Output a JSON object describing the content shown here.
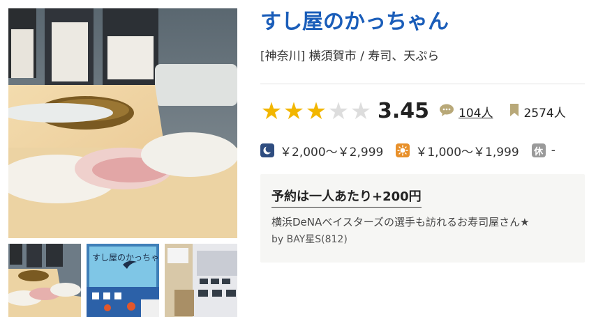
{
  "restaurant": {
    "name": "すし屋のかっちゃん",
    "area": "[神奈川] 横須賀市 / 寿司、天ぷら"
  },
  "rating": {
    "score": "3.45",
    "stars_filled": 3,
    "stars_total": 5,
    "review_count": "104人",
    "save_count": "2574人"
  },
  "prices": {
    "dinner": "￥2,000～￥2,999",
    "lunch": "￥1,000～￥1,999",
    "holiday_badge": "休",
    "holiday": "-"
  },
  "promo": {
    "title": "予約は一人あたり+200円",
    "description": "横浜DeNAベイスターズの選手も訪れるお寿司屋さん★",
    "byline": "by BAY星S(812)"
  },
  "photos": {
    "thumb_2_sign_text": "すし屋のかっちゃん"
  },
  "colors": {
    "title": "#1a5db9",
    "star_on": "#f2b600",
    "star_off": "#dddddd"
  },
  "icons": {
    "review": "speech-bubble-icon",
    "save": "bookmark-icon",
    "dinner": "moon-icon",
    "lunch": "sun-icon"
  }
}
